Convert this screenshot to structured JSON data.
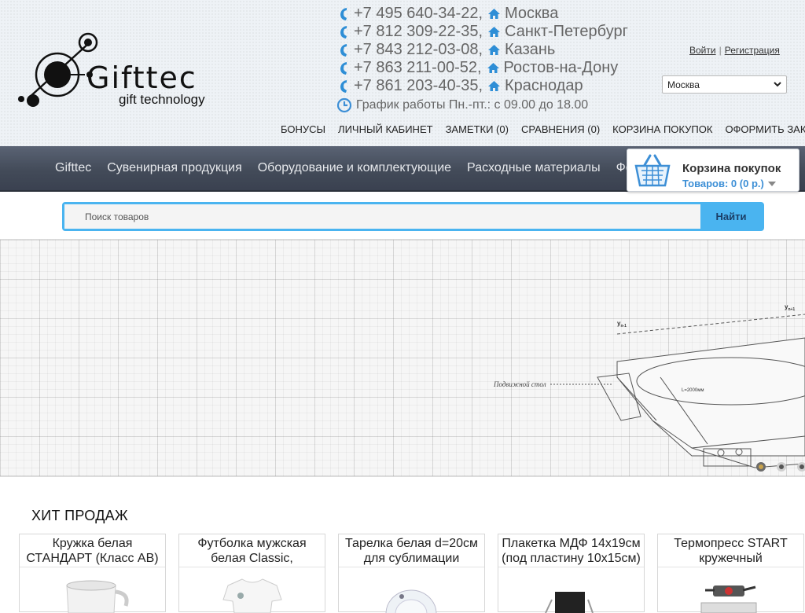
{
  "logo": {
    "brand": "Gifttec",
    "tagline": "gift technology"
  },
  "contacts": [
    {
      "phone": "+7 495 640-34-22,",
      "city": "Москва"
    },
    {
      "phone": "+7 812 309-22-35,",
      "city": "Санкт-Петербург"
    },
    {
      "phone": "+7 843 212-03-08,",
      "city": "Казань"
    },
    {
      "phone": "+7 863 211-00-52,",
      "city": "Ростов-на-Дону"
    },
    {
      "phone": "+7 861 203-40-35,",
      "city": "Краснодар"
    }
  ],
  "schedule": "График работы Пн.-пт.: с 09.00 до 18.00",
  "auth": {
    "login": "Войти",
    "separator": "|",
    "register": "Регистрация"
  },
  "city_select": {
    "selected": "Москва"
  },
  "toplinks": [
    "БОНУСЫ",
    "ЛИЧНЫЙ КАБИНЕТ",
    "ЗАМЕТКИ (0)",
    "СРАВНЕНИЯ (0)",
    "КОРЗИНА ПОКУПОК",
    "ОФОРМИТЬ ЗАКАЗ"
  ],
  "nav": [
    "Gifttec",
    "Сувенирная продукция",
    "Оборудование и комплектующие",
    "Расходные материалы",
    "Фо"
  ],
  "cart": {
    "title": "Корзина покупок",
    "summary": "Товаров: 0 (0 р.)"
  },
  "search": {
    "placeholder": "Поиск товаров",
    "button": "Найти"
  },
  "banner": {
    "label": "Подвижной стол",
    "dim_label": "L=2000мм",
    "y1": "y",
    "y1_sub": "n-1",
    "y2": "y",
    "y2_sub": "n+1",
    "slides": 3,
    "active_slide": 1
  },
  "section_title": "ХИТ ПРОДАЖ",
  "products": [
    {
      "name": "Кружка белая СТАНДАРТ (Класс АВ)"
    },
    {
      "name": "Футболка мужская белая Classic,"
    },
    {
      "name": "Тарелка белая d=20см для сублимации"
    },
    {
      "name": "Плакетка МДФ 14х19см (под пластину 10х15см)"
    },
    {
      "name": "Термопресс START кружечный"
    }
  ],
  "colors": {
    "accent": "#4ab4f0",
    "nav_bg": "#434b59",
    "link_blue": "#3d8fd6",
    "phone_icon": "#2e8ed6"
  }
}
